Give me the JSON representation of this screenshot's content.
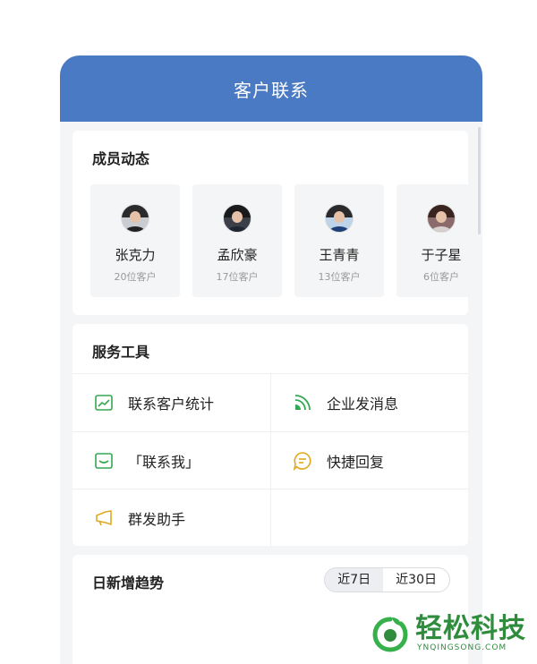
{
  "header": {
    "title": "客户联系"
  },
  "members": {
    "title": "成员动态",
    "items": [
      {
        "name": "张克力",
        "count": "20位客户"
      },
      {
        "name": "孟欣豪",
        "count": "17位客户"
      },
      {
        "name": "王青青",
        "count": "13位客户"
      },
      {
        "name": "于子星",
        "count": "6位客户"
      }
    ]
  },
  "tools": {
    "title": "服务工具",
    "items": [
      {
        "label": "联系客户统计",
        "icon": "chart-icon"
      },
      {
        "label": "企业发消息",
        "icon": "broadcast-icon"
      },
      {
        "label": "「联系我」",
        "icon": "message-icon"
      },
      {
        "label": "快捷回复",
        "icon": "quick-reply-icon"
      },
      {
        "label": "群发助手",
        "icon": "megaphone-icon"
      }
    ]
  },
  "trend": {
    "title": "日新增趋势",
    "tabs": [
      "近7日",
      "近30日"
    ],
    "active_tab": "近7日"
  },
  "watermark": {
    "main": "轻松科技",
    "sub": "YNQINGSONG.COM"
  },
  "colors": {
    "header": "#4a7ac3",
    "icon_green": "#33a852",
    "icon_yellow": "#e0a820",
    "watermark": "#2e8c3c"
  }
}
